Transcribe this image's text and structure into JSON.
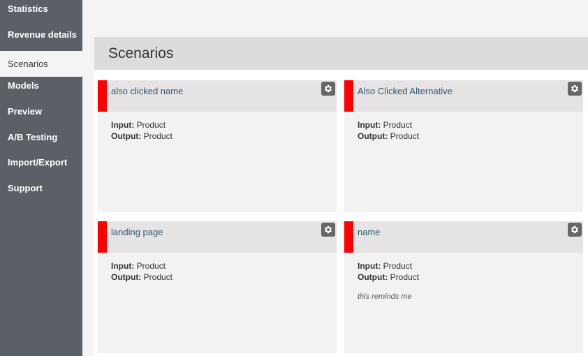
{
  "sidebar": {
    "items": [
      {
        "label": "Statistics"
      },
      {
        "label": "Revenue details"
      },
      {
        "label": "Scenarios"
      },
      {
        "label": "Models"
      },
      {
        "label": "Preview"
      },
      {
        "label": "A/B Testing"
      },
      {
        "label": "Import/Export"
      },
      {
        "label": "Support"
      }
    ],
    "active_index": 2
  },
  "page": {
    "title": "Scenarios"
  },
  "colors": {
    "accent_stripe": "#ff0000",
    "sidebar_bg": "#5a6066",
    "title_link": "#2f5570"
  },
  "cards": [
    {
      "title": "also clicked name",
      "input_label": "Input:",
      "input_value": "Product",
      "output_label": "Output:",
      "output_value": "Product",
      "note": ""
    },
    {
      "title": "Also Clicked Alternative",
      "input_label": "Input:",
      "input_value": "Product",
      "output_label": "Output:",
      "output_value": "Product",
      "note": ""
    },
    {
      "title": "landing page",
      "input_label": "Input:",
      "input_value": "Product",
      "output_label": "Output:",
      "output_value": "Product",
      "note": ""
    },
    {
      "title": "name",
      "input_label": "Input:",
      "input_value": "Product",
      "output_label": "Output:",
      "output_value": "Product",
      "note": "this reminds me"
    }
  ]
}
